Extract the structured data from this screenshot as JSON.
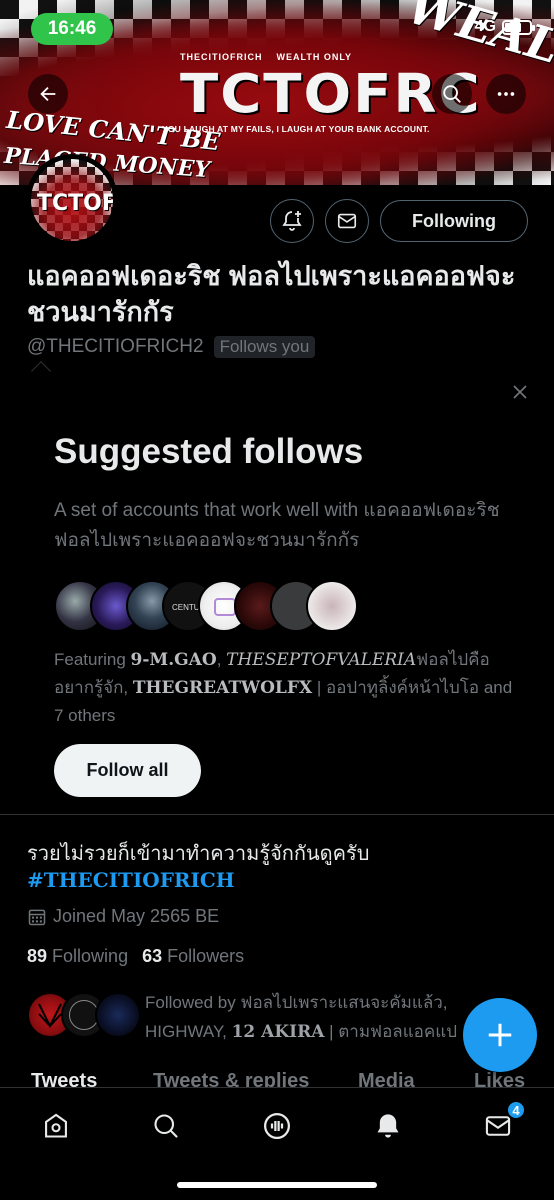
{
  "status_bar": {
    "time": "16:46",
    "network": "4G"
  },
  "banner": {
    "logo_text": "TCTOFRC",
    "logo_top_left": "THECITIOFRICH",
    "logo_top_right": "WEALTH ONLY",
    "tagline": "YOU LAUGH AT MY FAILS, I LAUGH AT YOUR BANK ACCOUNT.",
    "graffiti_left": "LOVE CAN'T BE",
    "graffiti_left2": "PLACED MONEY",
    "graffiti_right": "WEALTH"
  },
  "profile": {
    "avatar_text": "TCTOFRC",
    "display_name": "แอคออฟเดอะริช ฟอลไปเพราะแอคออฟจะชวนมารักกัร",
    "handle": "@THECITIOFRICH2",
    "follows_you": "Follows you",
    "following_button": "Following"
  },
  "suggested": {
    "title": "Suggested follows",
    "description": "A set of accounts that work well with แอคออฟเดอะริช ฟอลไปเพราะแอคออฟจะชวนมารักกัร",
    "featuring_prefix": "Featuring ",
    "featuring_name1": "9-M.GAO",
    "featuring_sep1": ", ",
    "featuring_name2": "THESEPTOFVALERIA",
    "featuring_mid": "ฟอลไปคืออยากรู้จัก, ",
    "featuring_name3": "THEGREATWOLFX",
    "featuring_tail": " | ออปาทูลิ้งค์หน้าไบโอ and 7 others",
    "follow_all": "Follow all"
  },
  "bio": {
    "text": "รวยไม่รวยก็เข้ามาทำความรู้จักกันดูครับ",
    "hashtag": "#THECITIOFRICH",
    "joined": "Joined May 2565 BE",
    "following_count": "89",
    "following_label": "Following",
    "followers_count": "63",
    "followers_label": "Followers",
    "followed_by_line1": "Followed by ฟอลไปเพราะแสนจะคัมแล้ว,",
    "followed_by_line2_prefix": "HIGHWAY, ",
    "followed_by_line2_bold": "12 AKIRA",
    "followed_by_line2_suffix": " | ตามฟอลแอคแป"
  },
  "tabs": [
    "Tweets",
    "Tweets & replies",
    "Media",
    "Likes"
  ],
  "nav": {
    "messages_badge": "4"
  },
  "colors": {
    "accent": "#1d9bf0",
    "status_green": "#31c44a"
  }
}
